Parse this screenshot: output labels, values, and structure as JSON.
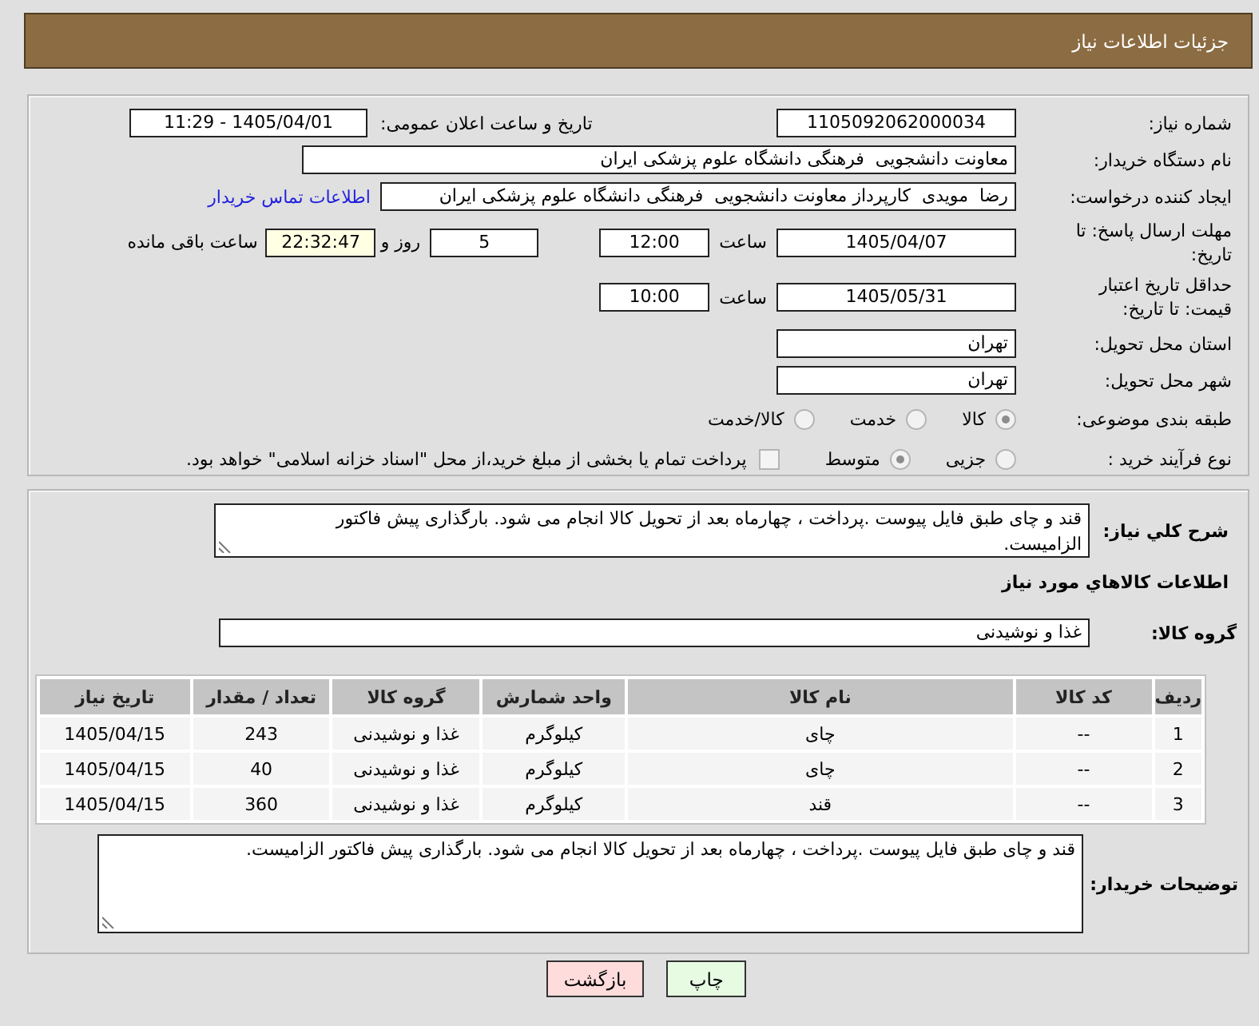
{
  "header": {
    "title": "جزئیات اطلاعات نیاز"
  },
  "details": {
    "need_number": {
      "label": "شماره نیاز:",
      "value": "1105092062000034"
    },
    "announce": {
      "label": "تاریخ و ساعت اعلان عمومی:",
      "value": "1405/04/01 - 11:29"
    },
    "buyer_org": {
      "label": "نام دستگاه خریدار:",
      "value": "معاونت دانشجویی  فرهنگی دانشگاه علوم پزشکی ایران"
    },
    "requester": {
      "label": "ایجاد کننده درخواست:",
      "value": "رضا  مویدی  کارپرداز معاونت دانشجویی  فرهنگی دانشگاه علوم پزشکی ایران",
      "link": "اطلاعات تماس خریدار"
    },
    "deadline": {
      "label": "مهلت ارسال پاسخ: تا تاریخ:",
      "date": "1405/04/07",
      "time_label": "ساعت",
      "time": "12:00",
      "days": "5",
      "days_label": "روز و",
      "remaining": "22:32:47",
      "remaining_label": "ساعت باقی مانده"
    },
    "validity": {
      "label": "حداقل تاریخ اعتبار قیمت: تا تاریخ:",
      "date": "1405/05/31",
      "time_label": "ساعت",
      "time": "10:00"
    },
    "province": {
      "label": "استان محل تحویل:",
      "value": "تهران"
    },
    "city": {
      "label": "شهر محل تحویل:",
      "value": "تهران"
    },
    "category": {
      "label": "طبقه بندی موضوعی:",
      "options": [
        {
          "label": "کالا",
          "selected": true
        },
        {
          "label": "خدمت",
          "selected": false
        },
        {
          "label": "کالا/خدمت",
          "selected": false
        }
      ]
    },
    "process": {
      "label": "نوع فرآیند خرید :",
      "options": [
        {
          "label": "جزیی",
          "selected": false
        },
        {
          "label": "متوسط",
          "selected": true
        }
      ],
      "treasury": {
        "label": "پرداخت تمام یا بخشی از مبلغ خرید،از محل \"اسناد خزانه اسلامی\" خواهد بود.",
        "checked": false
      }
    }
  },
  "needs": {
    "description": {
      "label": "شرح کلي نیاز:",
      "value": "قند و چای طبق فایل پیوست .پرداخت ، چهارماه بعد از تحویل کالا انجام می شود. بارگذاری پیش فاکتور الزامیست."
    },
    "goods_heading": "اطلاعات کالاهاي مورد نیاز",
    "goods_group": {
      "label": "گروه کالا:",
      "value": "غذا و نوشیدنی"
    },
    "table": {
      "columns": [
        "ردیف",
        "کد کالا",
        "نام کالا",
        "واحد شمارش",
        "گروه کالا",
        "تعداد / مقدار",
        "تاریخ نیاز"
      ],
      "rows": [
        [
          "1",
          "--",
          "چای",
          "کیلوگرم",
          "غذا و نوشیدنی",
          "243",
          "1405/04/15"
        ],
        [
          "2",
          "--",
          "چای",
          "کیلوگرم",
          "غذا و نوشیدنی",
          "40",
          "1405/04/15"
        ],
        [
          "3",
          "--",
          "قند",
          "کیلوگرم",
          "غذا و نوشیدنی",
          "360",
          "1405/04/15"
        ]
      ]
    },
    "buyer_notes": {
      "label": "توضیحات خریدار:",
      "value": "قند و چای طبق فایل پیوست .پرداخت ، چهارماه بعد از تحویل کالا انجام می شود. بارگذاری پیش فاکتور الزامیست."
    }
  },
  "buttons": [
    {
      "label": "چاپ",
      "kind": "print"
    },
    {
      "label": "بازگشت",
      "kind": "back"
    }
  ]
}
